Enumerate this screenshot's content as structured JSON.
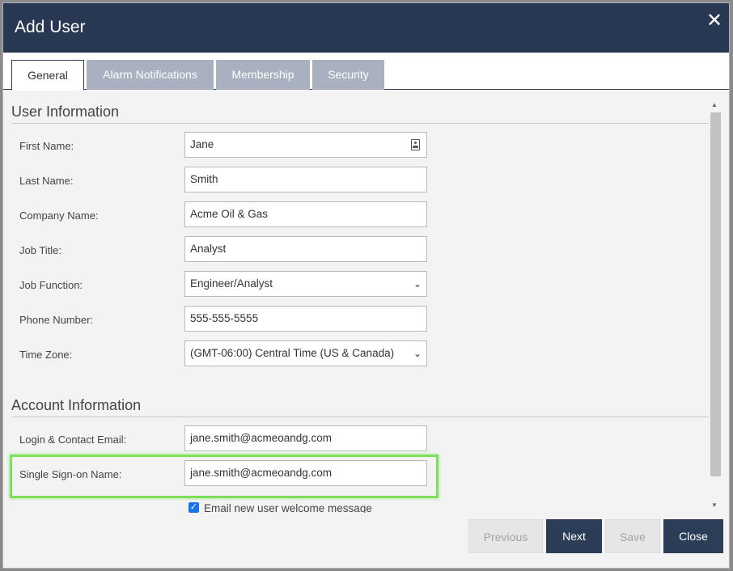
{
  "dialog": {
    "title": "Add User",
    "close_glyph": "✕"
  },
  "tabs": [
    {
      "label": "General",
      "active": true
    },
    {
      "label": "Alarm Notifications",
      "active": false
    },
    {
      "label": "Membership",
      "active": false
    },
    {
      "label": "Security",
      "active": false
    }
  ],
  "user_information": {
    "heading": "User Information",
    "first_name": {
      "label": "First Name:",
      "value": "Jane"
    },
    "last_name": {
      "label": "Last Name:",
      "value": "Smith"
    },
    "company_name": {
      "label": "Company Name:",
      "value": "Acme Oil & Gas"
    },
    "job_title": {
      "label": "Job Title:",
      "value": "Analyst"
    },
    "job_function": {
      "label": "Job Function:",
      "value": "Engineer/Analyst"
    },
    "phone_number": {
      "label": "Phone Number:",
      "value": "555-555-5555"
    },
    "time_zone": {
      "label": "Time Zone:",
      "value": "(GMT-06:00) Central Time (US & Canada)"
    }
  },
  "account_information": {
    "heading": "Account Information",
    "login_email": {
      "label": "Login & Contact Email:",
      "value": "jane.smith@acmeoandg.com"
    },
    "sso_name": {
      "label": "Single Sign-on Name:",
      "value": "jane.smith@acmeoandg.com"
    },
    "welcome_message": {
      "label": "Email new user welcome message",
      "checked": true
    }
  },
  "buttons": {
    "previous": "Previous",
    "next": "Next",
    "save": "Save",
    "close": "Close"
  },
  "colors": {
    "header": "#283853",
    "primary_button": "#2c3e57",
    "inactive_tab": "#a9b0bf",
    "highlight": "#7ee05a",
    "checkbox": "#1a73e8"
  }
}
